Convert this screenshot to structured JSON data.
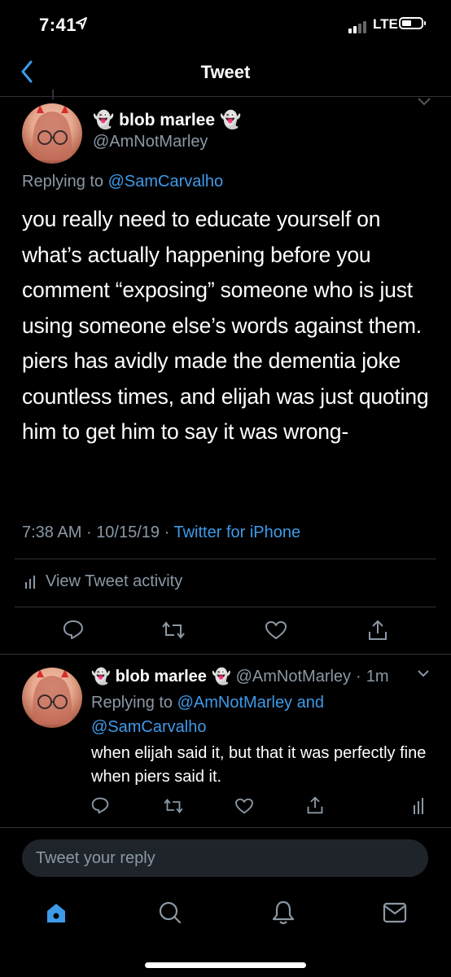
{
  "status_bar": {
    "time": "7:41",
    "network": "LTE"
  },
  "header": {
    "title": "Tweet"
  },
  "main_tweet": {
    "author_name": "blob marlee",
    "name_emoji": "👻",
    "handle": "@AmNotMarley",
    "replying_prefix": "Replying to",
    "replying_to": "@SamCarvalho",
    "text": "you really need to educate yourself on what’s actually happening before you comment “exposing” someone who is just using someone else’s words against them. piers has avidly made the dementia joke countless times, and elijah was just quoting him to get him to say it was wrong-",
    "time": "7:38 AM",
    "date": "10/15/19",
    "separator": "·",
    "source": "Twitter for iPhone",
    "activity_label": "View Tweet activity"
  },
  "reply_tweet": {
    "author_name": "blob marlee",
    "name_emoji": "👻",
    "handle": "@AmNotMarley",
    "age": "1m",
    "replying_prefix": "Replying to",
    "replying_to_1": "@AmNotMarley",
    "replying_and": "and",
    "replying_to_2": "@SamCarvalho",
    "text": "when elijah said it, but that it was perfectly fine when piers said it."
  },
  "composer": {
    "placeholder": "Tweet your reply"
  },
  "colors": {
    "accent": "#3e9ae8",
    "muted": "#8b98a5",
    "background": "#000000"
  },
  "icons": {
    "action_bar": [
      "reply-icon",
      "retweet-icon",
      "like-icon",
      "share-icon"
    ],
    "tab_bar": [
      "home-icon",
      "search-icon",
      "notifications-icon",
      "messages-icon"
    ]
  }
}
